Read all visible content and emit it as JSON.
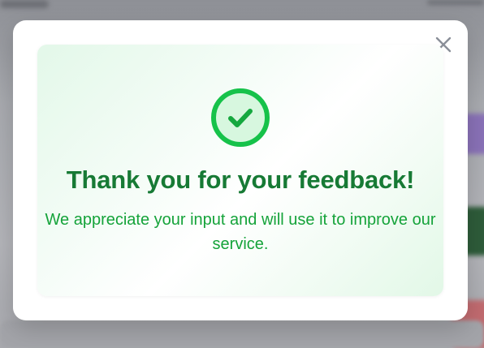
{
  "dialog": {
    "title": "Thank you for your feedback!",
    "message": "We appreciate your input and will use it to improve our service.",
    "close_icon": "close-icon",
    "status_icon": "check-circle-icon"
  },
  "colors": {
    "title": "#177a35",
    "message": "#15a33a",
    "check_ring": "#16c24a",
    "check_fill": "#d7f7df",
    "close_icon": "#8a8f98"
  }
}
